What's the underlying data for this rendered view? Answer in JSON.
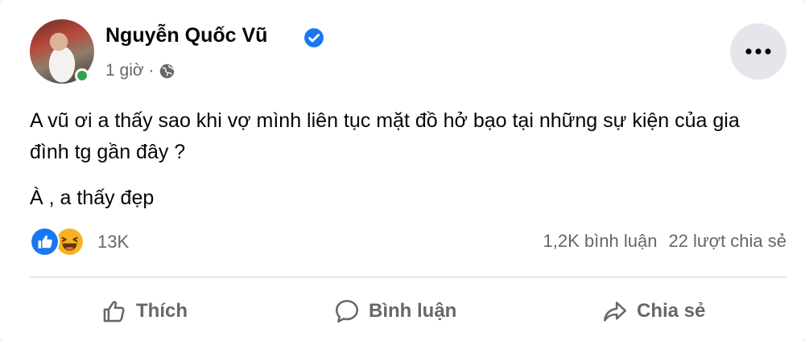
{
  "post": {
    "author_name": "Nguyễn Quốc Vũ",
    "time": "1 giờ ·",
    "paragraph_1": "A vũ ơi a thấy sao khi vợ mình liên tục mặt đồ hở bạo tại những sự kiện của gia đình tg gần đây ?",
    "paragraph_2": "À , a thấy đẹp"
  },
  "reactions": {
    "count": "13K",
    "icons": [
      "like-icon",
      "haha-icon"
    ]
  },
  "stats": {
    "comments": "1,2K bình luận",
    "shares": "22 lượt chia sẻ"
  },
  "actions": {
    "like_label": "Thích",
    "comment_label": "Bình luận",
    "share_label": "Chia sẻ"
  },
  "colors": {
    "verified": "#1877f2",
    "online": "#31a24c",
    "secondary_text": "#65676b"
  }
}
